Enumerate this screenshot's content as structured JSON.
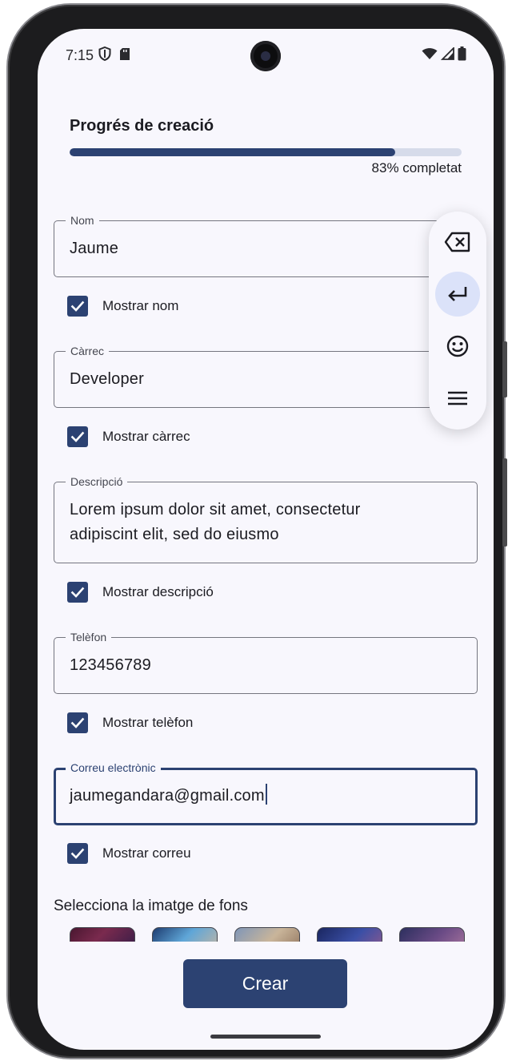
{
  "status_bar": {
    "time": "7:15",
    "left_icons": [
      "shield-icon",
      "sd-card-icon"
    ],
    "right_icons": [
      "wifi-icon",
      "signal-icon",
      "battery-icon"
    ]
  },
  "progress": {
    "title": "Progrés de creació",
    "value_percent": 83,
    "label": "83% completat"
  },
  "fields": {
    "nom": {
      "label": "Nom",
      "value": "Jaume"
    },
    "carrec": {
      "label": "Càrrec",
      "value": "Developer"
    },
    "descripcio": {
      "label": "Descripció",
      "value": "Lorem ipsum dolor sit amet, consectetur\nadipiscint elit, sed do eiusmo"
    },
    "telefon": {
      "label": "Telèfon",
      "value": "123456789"
    },
    "correu": {
      "label": "Correu electrònic",
      "value": "jaumegandara@gmail.com",
      "focused": true
    }
  },
  "checkboxes": {
    "nom": {
      "label": "Mostrar nom",
      "checked": true
    },
    "carrec": {
      "label": "Mostrar càrrec",
      "checked": true
    },
    "descripcio": {
      "label": "Mostrar descripció",
      "checked": true
    },
    "telefon": {
      "label": "Mostrar telèfon",
      "checked": true
    },
    "correu": {
      "label": "Mostrar correu",
      "checked": true
    }
  },
  "background_picker": {
    "title": "Selecciona la imatge de fons",
    "thumbnails": [
      "background-thumbnail-1",
      "background-thumbnail-2",
      "background-thumbnail-3",
      "background-thumbnail-4",
      "background-thumbnail-5"
    ]
  },
  "create_button": {
    "label": "Crear"
  },
  "keyboard_toolbar": {
    "buttons": [
      "backspace-icon",
      "enter-icon",
      "emoji-icon",
      "menu-icon"
    ],
    "active": "enter-icon"
  },
  "colors": {
    "primary": "#2c4272",
    "background": "#f8f7fd",
    "track": "#d6dbea",
    "outline": "#75767f",
    "active_chip": "#dbe2f9"
  }
}
